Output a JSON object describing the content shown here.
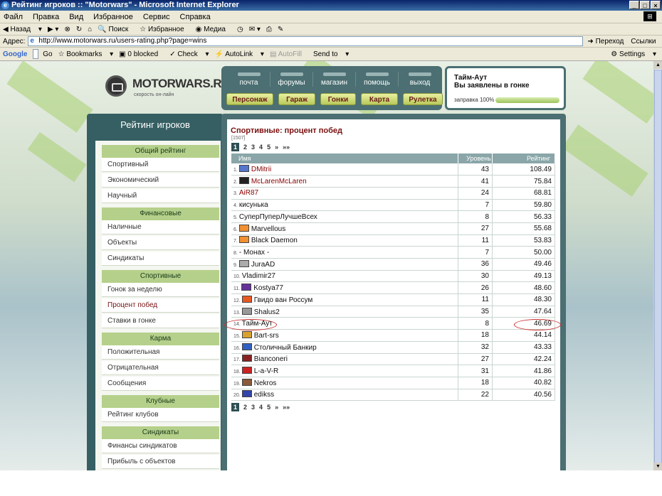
{
  "window": {
    "title": "Рейтинг игроков :: \"Motorwars\" - Microsoft Internet Explorer"
  },
  "menu": [
    "Файл",
    "Правка",
    "Вид",
    "Избранное",
    "Сервис",
    "Справка"
  ],
  "toolbar": {
    "back": "Назад",
    "search": "Поиск",
    "favorites": "Избранное",
    "media": "Медиа"
  },
  "address": {
    "label": "Адрес:",
    "url": "http://www.motorwars.ru/users-rating.php?page=wins",
    "go": "Переход",
    "links": "Ссылки"
  },
  "google": {
    "brand": "Google",
    "go": "Go",
    "bookmarks": "Bookmarks",
    "blocked": "0 blocked",
    "check": "Check",
    "autolink": "AutoLink",
    "autofill": "AutoFill",
    "sendto": "Send to",
    "settings": "Settings"
  },
  "logo": {
    "name": "MOTORWARS.RU",
    "tagline": "скорость он-лайн"
  },
  "top_tabs": [
    "почта",
    "форумы",
    "магазин",
    "помощь",
    "выход"
  ],
  "sub_tabs": [
    "Персонаж",
    "Гараж",
    "Гонки",
    "Карта",
    "Рулетка"
  ],
  "user": {
    "name": "Тайм-Аут",
    "status": "Вы заявлены в гонке",
    "fuel": "заправка 100%",
    "fuel_level": 1.0
  },
  "sidebar": {
    "title": "Рейтинг игроков",
    "sections": [
      {
        "head": "Общий рейтинг",
        "items": [
          "Спортивный",
          "Экономический",
          "Научный"
        ]
      },
      {
        "head": "Финансовые",
        "items": [
          "Наличные",
          "Объекты",
          "Синдикаты"
        ]
      },
      {
        "head": "Спортивные",
        "items": [
          "Гонок за неделю",
          "Процент побед",
          "Ставки в гонке"
        ]
      },
      {
        "head": "Карма",
        "items": [
          "Положительная",
          "Отрицательная",
          "Сообщения"
        ]
      },
      {
        "head": "Клубные",
        "items": [
          "Рейтинг клубов"
        ]
      },
      {
        "head": "Синдикаты",
        "items": [
          "Финансы синдикатов",
          "Прибыль с объектов"
        ]
      }
    ],
    "active": "Процент побед"
  },
  "content": {
    "title": "Спортивные: процент побед",
    "count": "[1507]",
    "pages": [
      "1",
      "2",
      "3",
      "4",
      "5",
      "»",
      "»»"
    ],
    "columns": [
      "Имя",
      "Уровень",
      "Рейтинг"
    ],
    "rows": [
      {
        "rank": "1.",
        "name": "DMitrii",
        "level": "43",
        "rating": "108.49",
        "icon": "#5577cc",
        "red": true
      },
      {
        "rank": "2.",
        "name": "McLarenMcLaren",
        "level": "41",
        "rating": "75.84",
        "icon": "#222",
        "red": true
      },
      {
        "rank": "3.",
        "name": "AiR87",
        "level": "24",
        "rating": "68.81",
        "icon": "",
        "red": true
      },
      {
        "rank": "4.",
        "name": "кисунька",
        "level": "7",
        "rating": "59.80",
        "icon": "",
        "red": false
      },
      {
        "rank": "5.",
        "name": "СуперПуперЛучшеВсех",
        "level": "8",
        "rating": "56.33",
        "icon": "",
        "red": false
      },
      {
        "rank": "6.",
        "name": "Marvellous",
        "level": "27",
        "rating": "55.68",
        "icon": "#f09030",
        "red": false
      },
      {
        "rank": "7.",
        "name": "Black Daemon",
        "level": "11",
        "rating": "53.83",
        "icon": "#f09030",
        "red": false
      },
      {
        "rank": "8.",
        "name": "- Монах -",
        "level": "7",
        "rating": "50.00",
        "icon": "",
        "red": false
      },
      {
        "rank": "9.",
        "name": "JuraAD",
        "level": "36",
        "rating": "49.46",
        "icon": "#aaa",
        "red": false
      },
      {
        "rank": "10.",
        "name": "Vladimir27",
        "level": "30",
        "rating": "49.13",
        "icon": "",
        "red": false
      },
      {
        "rank": "11.",
        "name": "Kostya77",
        "level": "26",
        "rating": "48.60",
        "icon": "#663399",
        "red": false
      },
      {
        "rank": "12.",
        "name": "Гвидо ван Россум",
        "level": "11",
        "rating": "48.30",
        "icon": "#e85a20",
        "red": false
      },
      {
        "rank": "13.",
        "name": "Shalus2",
        "level": "35",
        "rating": "47.64",
        "icon": "#999",
        "red": false
      },
      {
        "rank": "14.",
        "name": "Тайм-Аут",
        "level": "8",
        "rating": "46.69",
        "icon": "",
        "red": false
      },
      {
        "rank": "15.",
        "name": "Bart-srs",
        "level": "18",
        "rating": "44.14",
        "icon": "#d8a030",
        "red": false
      },
      {
        "rank": "16.",
        "name": "Столичный Банкир",
        "level": "32",
        "rating": "43.33",
        "icon": "#3060c0",
        "red": false
      },
      {
        "rank": "17.",
        "name": "Bianconeri",
        "level": "27",
        "rating": "42.24",
        "icon": "#882222",
        "red": false
      },
      {
        "rank": "18.",
        "name": "L-a-V-R",
        "level": "31",
        "rating": "41.86",
        "icon": "#cc2222",
        "red": false
      },
      {
        "rank": "19.",
        "name": "Nekros",
        "level": "18",
        "rating": "40.82",
        "icon": "#8a5a3a",
        "red": false
      },
      {
        "rank": "20.",
        "name": "edikss",
        "level": "22",
        "rating": "40.56",
        "icon": "#3344aa",
        "red": false
      }
    ]
  }
}
